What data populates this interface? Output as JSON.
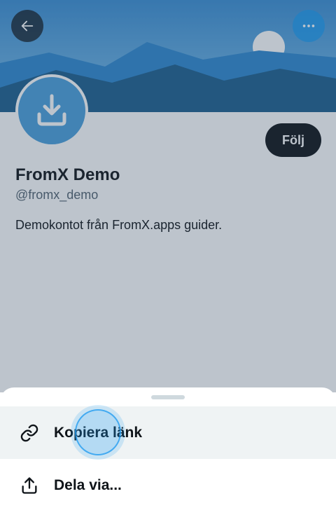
{
  "profile": {
    "display_name": "FromX Demo",
    "handle": "@fromx_demo",
    "bio": "Demokontot från FromX.apps guider.",
    "follow_label": "Följ"
  },
  "icons": {
    "back": "arrow-left-icon",
    "more": "more-horizontal-icon",
    "avatar": "download-icon",
    "copy": "link-icon",
    "share": "share-icon"
  },
  "sheet": {
    "items": [
      {
        "label": "Kopiera länk",
        "icon": "link-icon",
        "highlighted": true
      },
      {
        "label": "Dela via...",
        "icon": "share-icon",
        "highlighted": false
      }
    ]
  },
  "colors": {
    "accent": "#1d9bf0",
    "text_primary": "#0f1419",
    "text_secondary": "#536471",
    "highlight_bg": "#eff3f4"
  }
}
